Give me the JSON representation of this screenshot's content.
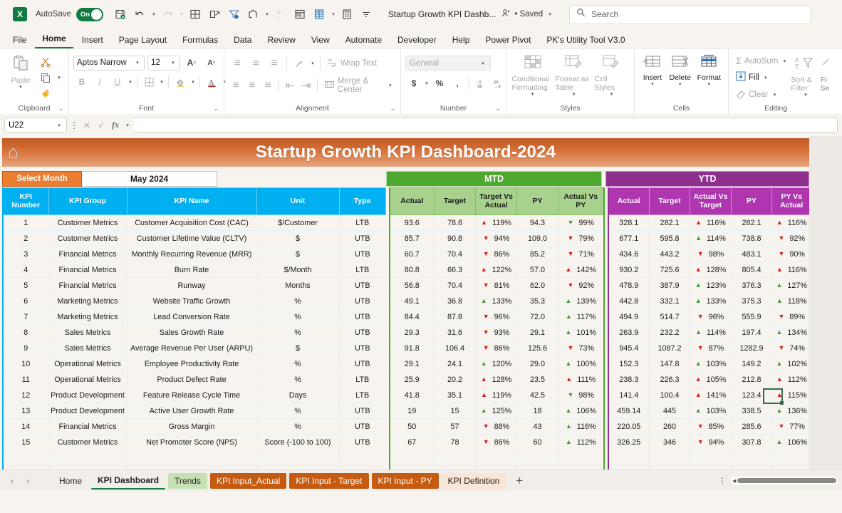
{
  "titlebar": {
    "autosave_label": "AutoSave",
    "autosave_state": "On",
    "document_title": "Startup Growth KPI Dashb...",
    "saved_status": "• Saved",
    "search_placeholder": "Search"
  },
  "ribbon_tabs": [
    "File",
    "Home",
    "Insert",
    "Page Layout",
    "Formulas",
    "Data",
    "Review",
    "View",
    "Automate",
    "Developer",
    "Help",
    "Power Pivot",
    "PK's Utility Tool V3.0"
  ],
  "ribbon_active_tab": "Home",
  "ribbon": {
    "clipboard": {
      "label": "Clipboard",
      "paste": "Paste"
    },
    "font": {
      "label": "Font",
      "font_name": "Aptos Narrow",
      "font_size": "12"
    },
    "alignment": {
      "label": "Alignment",
      "wrap_text": "Wrap Text",
      "merge_center": "Merge & Center"
    },
    "number": {
      "label": "Number",
      "format": "General"
    },
    "styles": {
      "label": "Styles",
      "conditional_formatting": "Conditional Formatting",
      "format_as_table": "Format as Table",
      "cell_styles": "Cell Styles"
    },
    "cells": {
      "label": "Cells",
      "insert": "Insert",
      "delete": "Delete",
      "format": "Format"
    },
    "editing": {
      "label": "Editing",
      "autosum": "AutoSum",
      "fill": "Fill",
      "clear": "Clear",
      "sort_filter": "Sort & Filter",
      "find_select": "Fi Se"
    }
  },
  "formula_bar": {
    "name_box": "U22",
    "formula_value": ""
  },
  "dashboard": {
    "title": "Startup Growth KPI Dashboard-2024",
    "select_month_label": "Select Month",
    "selected_month": "May 2024",
    "mtd_label": "MTD",
    "ytd_label": "YTD",
    "left_headers": [
      "KPI Number",
      "KPI Group",
      "KPI Name",
      "Unit",
      "Type"
    ],
    "mtd_headers": [
      "Actual",
      "Target",
      "Target Vs Actual",
      "PY",
      "Actual Vs PY"
    ],
    "ytd_headers": [
      "Actual",
      "Target",
      "Actual Vs Target",
      "PY",
      "PY Vs Actual"
    ],
    "rows": [
      {
        "num": "1",
        "group": "Customer Metrics",
        "name": "Customer Acquisition Cost (CAC)",
        "unit": "$/Customer",
        "type": "LTB",
        "mtd": {
          "actual": "93.6",
          "target": "78.6",
          "tva": "119%",
          "tva_dir": "up",
          "tva_color": "red",
          "py": "94.3",
          "avp": "99%",
          "avp_dir": "down",
          "avp_color": "green"
        },
        "ytd": {
          "actual": "328.1",
          "target": "282.1",
          "avt": "116%",
          "avt_dir": "up",
          "avt_color": "red",
          "py": "282.1",
          "pva": "116%",
          "pva_dir": "up",
          "pva_color": "red"
        }
      },
      {
        "num": "2",
        "group": "Customer Metrics",
        "name": "Customer Lifetime Value (CLTV)",
        "unit": "$",
        "type": "UTB",
        "mtd": {
          "actual": "85.7",
          "target": "90.8",
          "tva": "94%",
          "tva_dir": "down",
          "tva_color": "red",
          "py": "109.0",
          "avp": "79%",
          "avp_dir": "down",
          "avp_color": "red"
        },
        "ytd": {
          "actual": "677.1",
          "target": "595.8",
          "avt": "114%",
          "avt_dir": "up",
          "avt_color": "green",
          "py": "738.8",
          "pva": "92%",
          "pva_dir": "down",
          "pva_color": "red"
        }
      },
      {
        "num": "3",
        "group": "Financial Metrics",
        "name": "Monthly Recurring Revenue (MRR)",
        "unit": "$",
        "type": "UTB",
        "mtd": {
          "actual": "60.7",
          "target": "70.4",
          "tva": "86%",
          "tva_dir": "down",
          "tva_color": "red",
          "py": "85.2",
          "avp": "71%",
          "avp_dir": "down",
          "avp_color": "red"
        },
        "ytd": {
          "actual": "434.6",
          "target": "443.2",
          "avt": "98%",
          "avt_dir": "down",
          "avt_color": "red",
          "py": "483.1",
          "pva": "90%",
          "pva_dir": "down",
          "pva_color": "red"
        }
      },
      {
        "num": "4",
        "group": "Financial Metrics",
        "name": "Burn Rate",
        "unit": "$/Month",
        "type": "LTB",
        "mtd": {
          "actual": "80.8",
          "target": "66.3",
          "tva": "122%",
          "tva_dir": "up",
          "tva_color": "red",
          "py": "57.0",
          "avp": "142%",
          "avp_dir": "up",
          "avp_color": "red"
        },
        "ytd": {
          "actual": "930.2",
          "target": "725.6",
          "avt": "128%",
          "avt_dir": "up",
          "avt_color": "red",
          "py": "805.4",
          "pva": "116%",
          "pva_dir": "up",
          "pva_color": "red"
        }
      },
      {
        "num": "5",
        "group": "Financial Metrics",
        "name": "Runway",
        "unit": "Months",
        "type": "UTB",
        "mtd": {
          "actual": "56.8",
          "target": "70.4",
          "tva": "81%",
          "tva_dir": "down",
          "tva_color": "red",
          "py": "62.0",
          "avp": "92%",
          "avp_dir": "down",
          "avp_color": "red"
        },
        "ytd": {
          "actual": "478.9",
          "target": "387.9",
          "avt": "123%",
          "avt_dir": "up",
          "avt_color": "green",
          "py": "376.3",
          "pva": "127%",
          "pva_dir": "up",
          "pva_color": "green"
        }
      },
      {
        "num": "6",
        "group": "Marketing Metrics",
        "name": "Website Traffic Growth",
        "unit": "%",
        "type": "UTB",
        "mtd": {
          "actual": "49.1",
          "target": "36.8",
          "tva": "133%",
          "tva_dir": "up",
          "tva_color": "green",
          "py": "35.3",
          "avp": "139%",
          "avp_dir": "up",
          "avp_color": "green"
        },
        "ytd": {
          "actual": "442.8",
          "target": "332.1",
          "avt": "133%",
          "avt_dir": "up",
          "avt_color": "green",
          "py": "375.3",
          "pva": "118%",
          "pva_dir": "up",
          "pva_color": "green"
        }
      },
      {
        "num": "7",
        "group": "Marketing Metrics",
        "name": "Lead Conversion Rate",
        "unit": "%",
        "type": "UTB",
        "mtd": {
          "actual": "84.4",
          "target": "87.8",
          "tva": "96%",
          "tva_dir": "down",
          "tva_color": "red",
          "py": "72.0",
          "avp": "117%",
          "avp_dir": "up",
          "avp_color": "green"
        },
        "ytd": {
          "actual": "494.9",
          "target": "514.7",
          "avt": "96%",
          "avt_dir": "down",
          "avt_color": "red",
          "py": "555.9",
          "pva": "89%",
          "pva_dir": "down",
          "pva_color": "red"
        }
      },
      {
        "num": "8",
        "group": "Sales Metrics",
        "name": "Sales Growth Rate",
        "unit": "%",
        "type": "UTB",
        "mtd": {
          "actual": "29.3",
          "target": "31.6",
          "tva": "93%",
          "tva_dir": "down",
          "tva_color": "red",
          "py": "29.1",
          "avp": "101%",
          "avp_dir": "up",
          "avp_color": "green"
        },
        "ytd": {
          "actual": "263.9",
          "target": "232.2",
          "avt": "114%",
          "avt_dir": "up",
          "avt_color": "green",
          "py": "197.4",
          "pva": "134%",
          "pva_dir": "up",
          "pva_color": "green"
        }
      },
      {
        "num": "9",
        "group": "Sales Metrics",
        "name": "Average Revenue Per User (ARPU)",
        "unit": "$",
        "type": "UTB",
        "mtd": {
          "actual": "91.8",
          "target": "106.4",
          "tva": "86%",
          "tva_dir": "down",
          "tva_color": "red",
          "py": "125.6",
          "avp": "73%",
          "avp_dir": "down",
          "avp_color": "red"
        },
        "ytd": {
          "actual": "945.4",
          "target": "1087.2",
          "avt": "87%",
          "avt_dir": "down",
          "avt_color": "red",
          "py": "1282.9",
          "pva": "74%",
          "pva_dir": "down",
          "pva_color": "red"
        }
      },
      {
        "num": "10",
        "group": "Operational Metrics",
        "name": "Employee Productivity Rate",
        "unit": "%",
        "type": "UTB",
        "mtd": {
          "actual": "29.1",
          "target": "24.1",
          "tva": "120%",
          "tva_dir": "up",
          "tva_color": "green",
          "py": "29.0",
          "avp": "100%",
          "avp_dir": "up",
          "avp_color": "green"
        },
        "ytd": {
          "actual": "152.3",
          "target": "147.8",
          "avt": "103%",
          "avt_dir": "up",
          "avt_color": "green",
          "py": "149.2",
          "pva": "102%",
          "pva_dir": "up",
          "pva_color": "green"
        }
      },
      {
        "num": "11",
        "group": "Operational Metrics",
        "name": "Product Defect Rate",
        "unit": "%",
        "type": "LTB",
        "mtd": {
          "actual": "25.9",
          "target": "20.2",
          "tva": "128%",
          "tva_dir": "up",
          "tva_color": "red",
          "py": "23.5",
          "avp": "111%",
          "avp_dir": "up",
          "avp_color": "red"
        },
        "ytd": {
          "actual": "238.3",
          "target": "226.3",
          "avt": "105%",
          "avt_dir": "up",
          "avt_color": "red",
          "py": "212.8",
          "pva": "112%",
          "pva_dir": "up",
          "pva_color": "red"
        }
      },
      {
        "num": "12",
        "group": "Product Development",
        "name": "Feature Release Cycle Time",
        "unit": "Days",
        "type": "LTB",
        "mtd": {
          "actual": "41.8",
          "target": "35.1",
          "tva": "119%",
          "tva_dir": "up",
          "tva_color": "red",
          "py": "42.5",
          "avp": "98%",
          "avp_dir": "down",
          "avp_color": "green"
        },
        "ytd": {
          "actual": "141.4",
          "target": "100.4",
          "avt": "141%",
          "avt_dir": "up",
          "avt_color": "red",
          "py": "123.4",
          "pva": "115%",
          "pva_dir": "up",
          "pva_color": "red"
        }
      },
      {
        "num": "13",
        "group": "Product Development",
        "name": "Active User Growth Rate",
        "unit": "%",
        "type": "UTB",
        "mtd": {
          "actual": "19",
          "target": "15",
          "tva": "125%",
          "tva_dir": "up",
          "tva_color": "green",
          "py": "18",
          "avp": "106%",
          "avp_dir": "up",
          "avp_color": "green"
        },
        "ytd": {
          "actual": "459.14",
          "target": "445",
          "avt": "103%",
          "avt_dir": "up",
          "avt_color": "green",
          "py": "338.5",
          "pva": "136%",
          "pva_dir": "up",
          "pva_color": "green"
        }
      },
      {
        "num": "14",
        "group": "Financial Metrics",
        "name": "Gross Margin",
        "unit": "%",
        "type": "UTB",
        "mtd": {
          "actual": "50",
          "target": "57",
          "tva": "88%",
          "tva_dir": "down",
          "tva_color": "red",
          "py": "43",
          "avp": "116%",
          "avp_dir": "up",
          "avp_color": "green"
        },
        "ytd": {
          "actual": "220.05",
          "target": "260",
          "avt": "85%",
          "avt_dir": "down",
          "avt_color": "red",
          "py": "285.6",
          "pva": "77%",
          "pva_dir": "down",
          "pva_color": "red"
        }
      },
      {
        "num": "15",
        "group": "Customer Metrics",
        "name": "Net Promoter Score (NPS)",
        "unit": "Score (-100 to 100)",
        "type": "UTB",
        "mtd": {
          "actual": "67",
          "target": "78",
          "tva": "86%",
          "tva_dir": "down",
          "tva_color": "red",
          "py": "60",
          "avp": "112%",
          "avp_dir": "up",
          "avp_color": "green"
        },
        "ytd": {
          "actual": "326.25",
          "target": "346",
          "avt": "94%",
          "avt_dir": "down",
          "avt_color": "red",
          "py": "307.8",
          "pva": "106%",
          "pva_dir": "up",
          "pva_color": "green"
        }
      }
    ]
  },
  "sheet_tabs": [
    {
      "label": "Home",
      "style": "plain"
    },
    {
      "label": "KPI Dashboard",
      "style": "active"
    },
    {
      "label": "Trends",
      "style": "greenbg"
    },
    {
      "label": "KPI Input_Actual",
      "style": "orangebg"
    },
    {
      "label": "KPI Input - Target",
      "style": "orangebg"
    },
    {
      "label": "KPI Input - PY",
      "style": "orangebg"
    },
    {
      "label": "KPI Definition",
      "style": "peachbg"
    }
  ],
  "colors": {
    "excel_green": "#107C41",
    "header_blue": "#00B0F0",
    "mtd_green": "#4EA72E",
    "mtd_light": "#A9D18E",
    "ytd_purple": "#8E2F8E",
    "ytd_light": "#B035B0",
    "orange": "#ED7D31",
    "banner_orange": "#C0551F",
    "up_red": "#D81C1C",
    "up_green": "#3E9B38"
  }
}
